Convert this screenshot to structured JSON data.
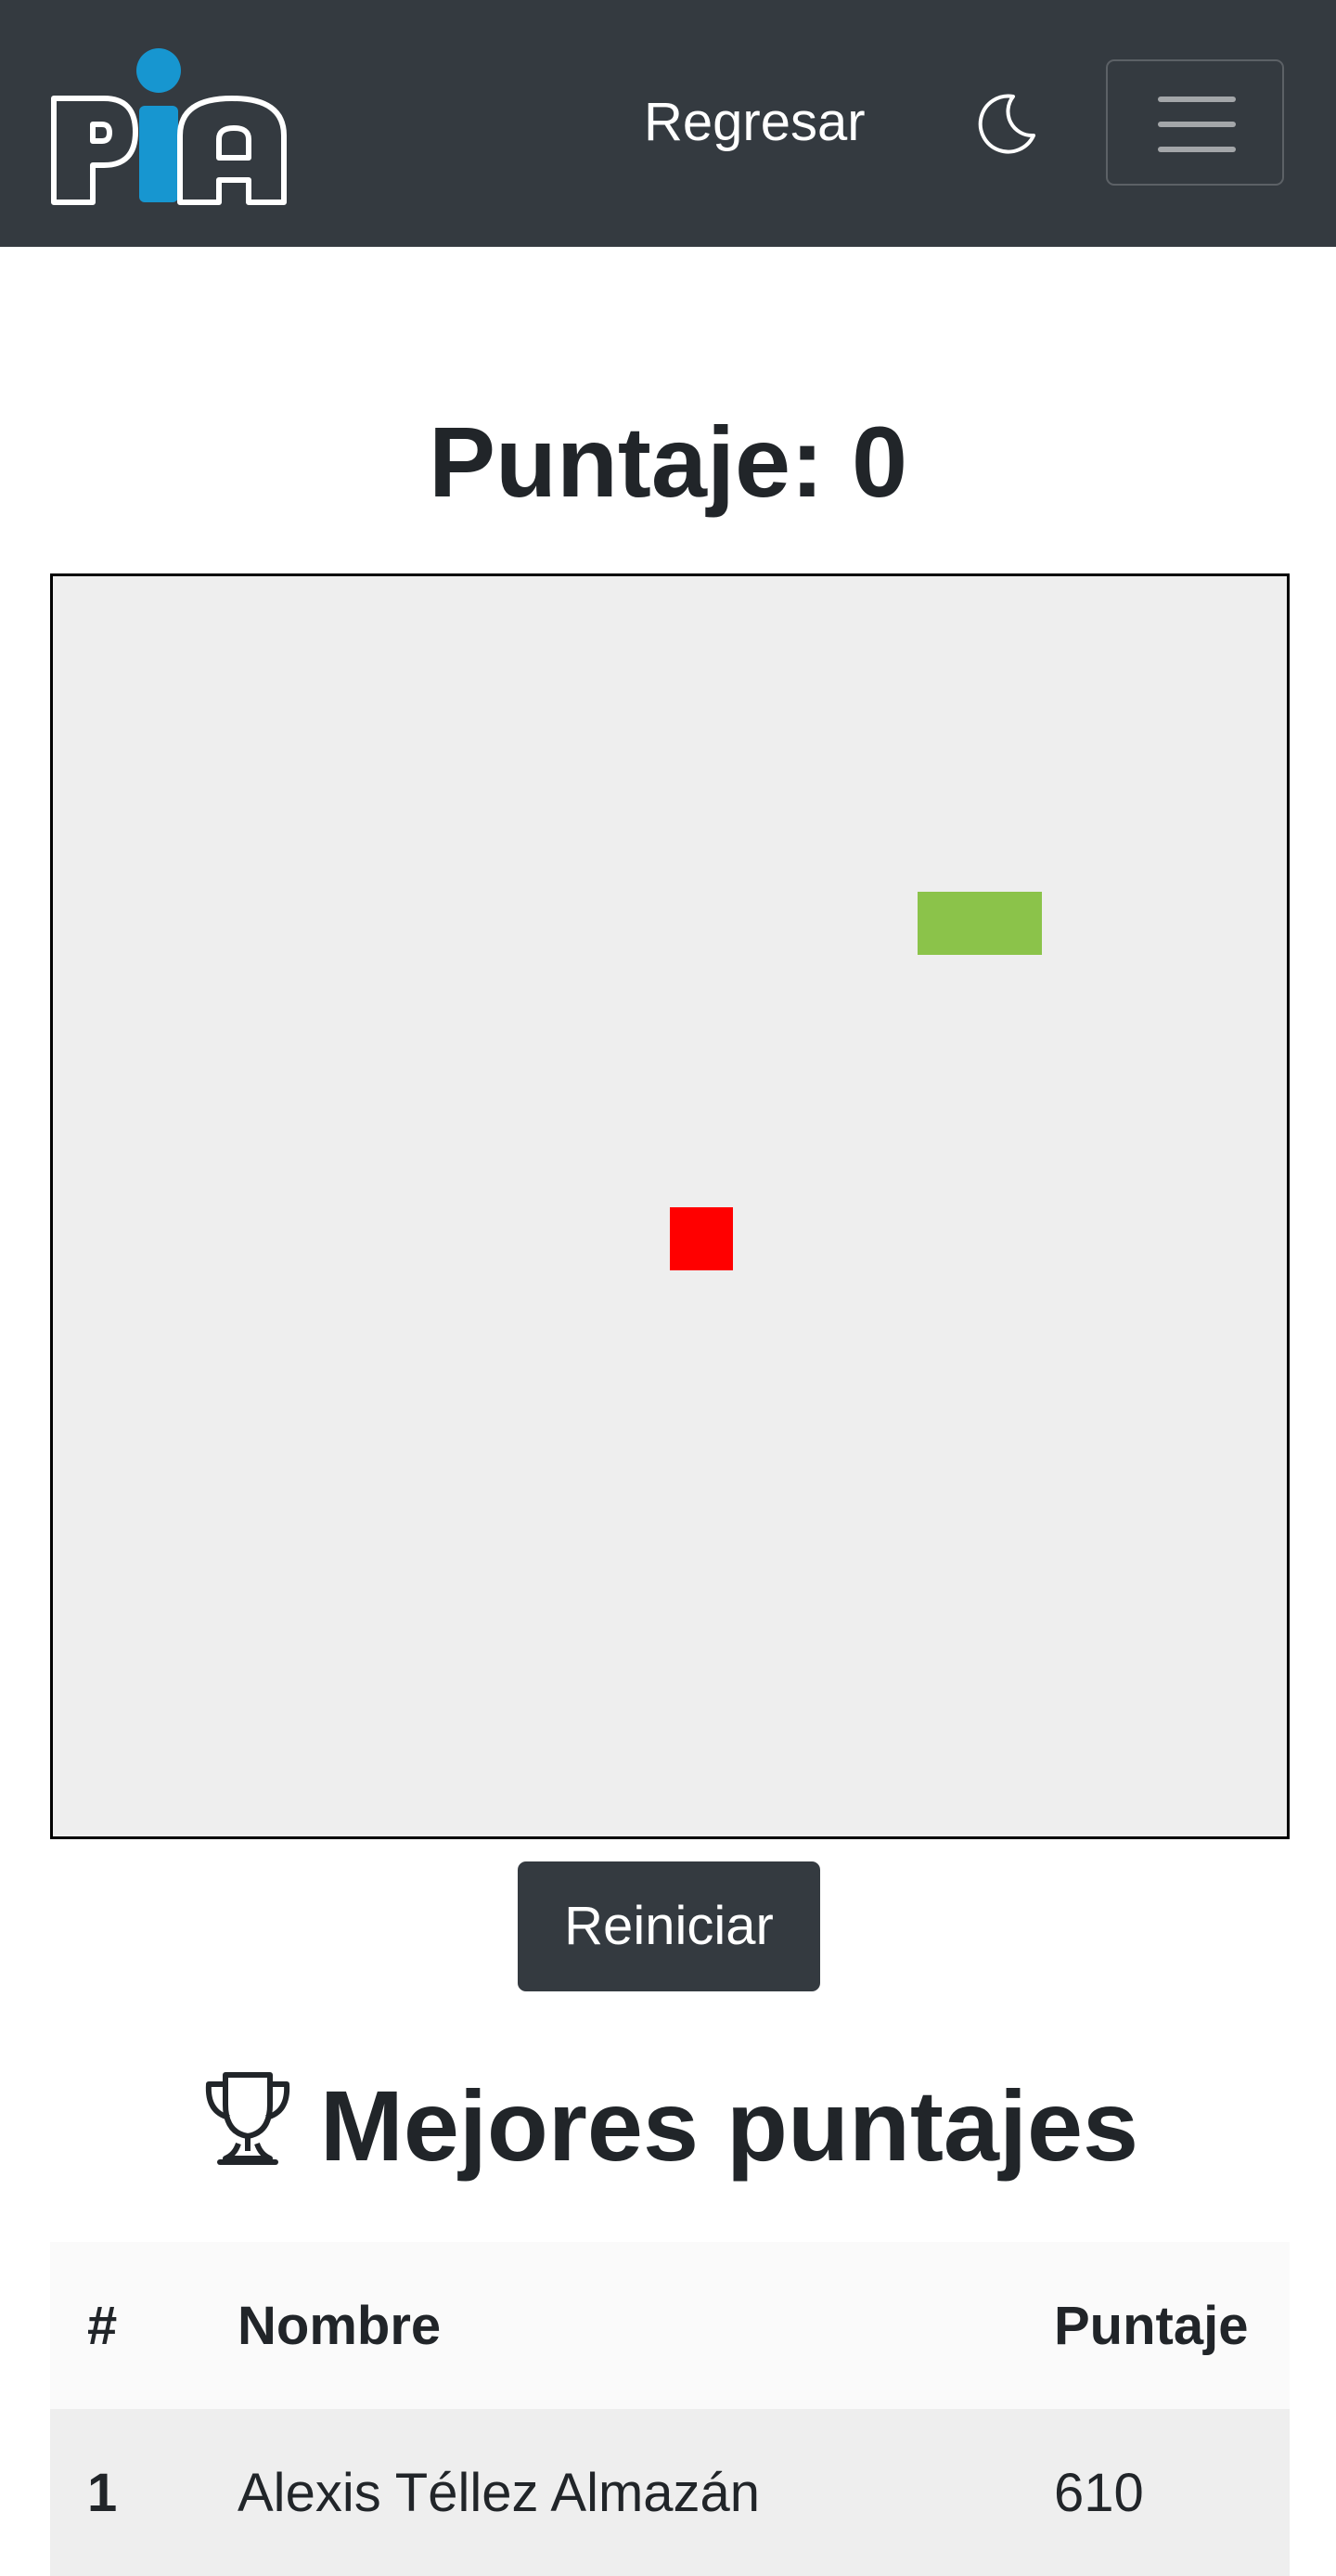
{
  "navbar": {
    "logo_text": "PIA",
    "back_label": "Regresar",
    "theme_icon": "moon-icon",
    "menu_icon": "hamburger-menu-icon",
    "background": "#343a40"
  },
  "game": {
    "score_label": "Puntaje: 0",
    "board_background": "#eeeeee",
    "snake_color": "#8bc34a",
    "food_color": "#ff0000",
    "restart_label": "Reiniciar"
  },
  "leaderboard": {
    "title": "Mejores puntajes",
    "title_icon": "trophy-icon",
    "columns": [
      "#",
      "Nombre",
      "Puntaje"
    ],
    "rows": [
      {
        "rank": "1",
        "name": "Alexis Téllez Almazán",
        "score": "610"
      }
    ]
  }
}
